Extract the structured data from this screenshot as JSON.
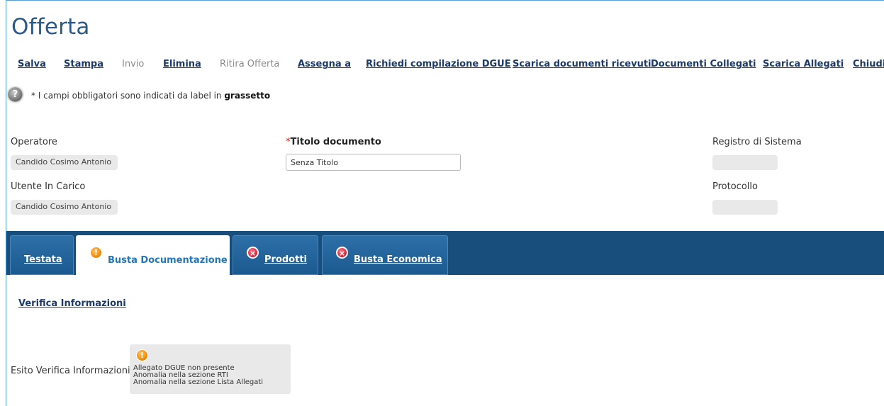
{
  "page": {
    "title": "Offerta"
  },
  "toolbar": [
    {
      "label": "Salva",
      "enabled": true
    },
    {
      "label": "Stampa",
      "enabled": true
    },
    {
      "label": "Invio",
      "enabled": false
    },
    {
      "label": "Elimina",
      "enabled": true
    },
    {
      "label": "Ritira Offerta",
      "enabled": false
    },
    {
      "label": "Assegna a",
      "enabled": true
    },
    {
      "label": "Richiedi compilazione DGUE",
      "enabled": true
    },
    {
      "label": "Scarica documenti ricevuti",
      "enabled": true
    },
    {
      "label": "Documenti Collegati",
      "enabled": true
    },
    {
      "label": "Scarica Allegati",
      "enabled": true
    },
    {
      "label": "Chiudi",
      "enabled": true
    }
  ],
  "help": {
    "icon": "help-icon",
    "text": "* I campi obbligatori sono indicati da label in ",
    "bold": "grassetto"
  },
  "fields": {
    "operatore": {
      "label": "Operatore",
      "value": "Candido Cosimo Antonio"
    },
    "utente": {
      "label": "Utente In Carico",
      "value": "Candido Cosimo Antonio"
    },
    "titolo": {
      "required_mark": "*",
      "label": "Titolo documento",
      "value": "Senza Titolo"
    },
    "registro": {
      "label": "Registro di Sistema",
      "value": ""
    },
    "protocollo": {
      "label": "Protocollo",
      "value": ""
    }
  },
  "tabs": [
    {
      "label": "Testata",
      "status_icon": "",
      "active": false
    },
    {
      "label": "Busta Documentazione",
      "status_icon": "warning-icon",
      "active": true
    },
    {
      "label": "Prodotti",
      "status_icon": "error-icon",
      "active": false
    },
    {
      "label": "Busta Economica",
      "status_icon": "error-icon",
      "active": false
    }
  ],
  "content": {
    "verify_link": "Verifica Informazioni",
    "esito_label": "Esito Verifica Informazioni",
    "esito_icon": "warning-icon",
    "esito_lines": [
      "Allegato DGUE non presente",
      "Anomalia nella sezione RTI",
      "Anomalia nella sezione Lista Allegati"
    ]
  },
  "colors": {
    "header_blue": "#174e7c",
    "link": "#1d3b6a",
    "active_tab_text": "#2276b9",
    "required": "#d0261f"
  }
}
